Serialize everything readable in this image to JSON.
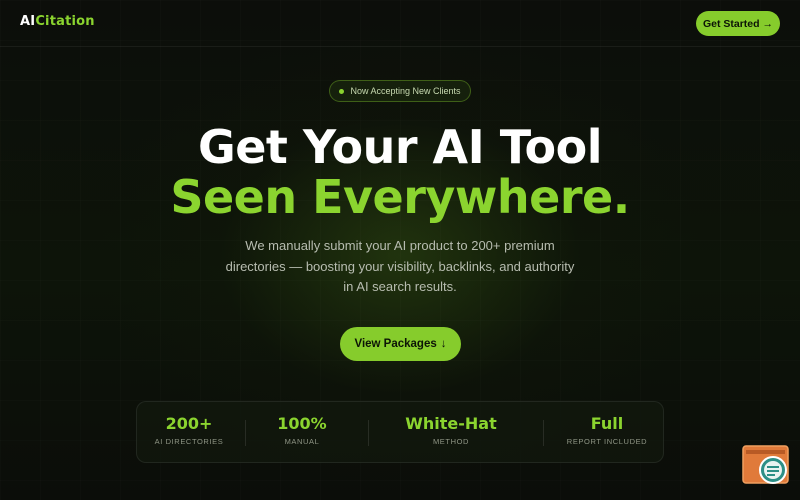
{
  "brand": {
    "part1": "AI",
    "part2": "Citation"
  },
  "nav": {
    "cta_label": "Get Started",
    "cta_icon": "arrow-right-icon"
  },
  "hero": {
    "badge": "Now Accepting New Clients",
    "headline_line1": "Get Your AI Tool",
    "headline_line2": "Seen Everywhere.",
    "subtitle": "We manually submit your AI product to 200+ premium directories — boosting your visibility, backlinks, and authority in AI search results.",
    "cta_label": "View Packages",
    "cta_icon": "arrow-down-icon"
  },
  "stats": [
    {
      "value": "200+",
      "label": "AI DIRECTORIES"
    },
    {
      "value": "100%",
      "label": "MANUAL"
    },
    {
      "value": "White-Hat",
      "label": "METHOD"
    },
    {
      "value": "Full",
      "label": "REPORT INCLUDED"
    }
  ],
  "colors": {
    "accent": "#8bd42f",
    "background": "#0b0d09",
    "text": "#ffffff"
  }
}
